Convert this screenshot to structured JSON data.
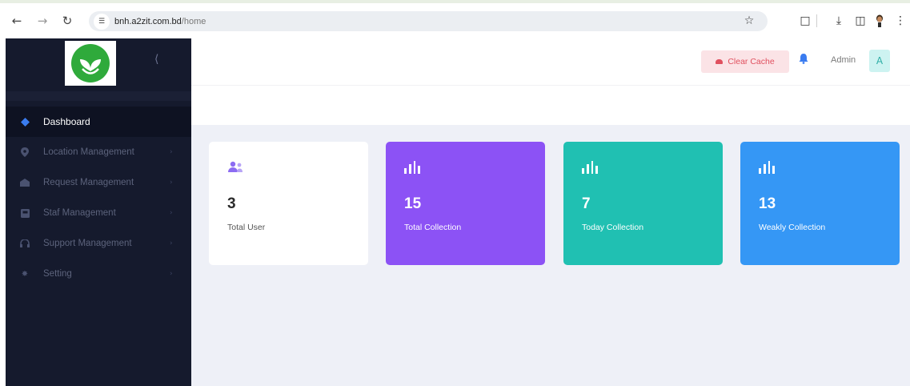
{
  "browser": {
    "url_host": "bnh.a2zit.com.bd",
    "url_path": "/home"
  },
  "sidebar": {
    "menu": [
      {
        "label": "Dashboard",
        "icon": "diamond-icon",
        "active": true,
        "has_arrow": false
      },
      {
        "label": "Location Management",
        "icon": "location-pin-icon",
        "active": false,
        "has_arrow": true
      },
      {
        "label": "Request Management",
        "icon": "request-icon",
        "active": false,
        "has_arrow": true
      },
      {
        "label": "Staf Management",
        "icon": "staff-icon",
        "active": false,
        "has_arrow": true
      },
      {
        "label": "Support Management",
        "icon": "headset-icon",
        "active": false,
        "has_arrow": true
      },
      {
        "label": "Setting",
        "icon": "gear-icon",
        "active": false,
        "has_arrow": true
      }
    ]
  },
  "header": {
    "clear_cache_label": "Clear Cache",
    "admin_label": "Admin",
    "avatar_initial": "A"
  },
  "cards": [
    {
      "value": "3",
      "label": "Total User",
      "icon": "users-icon",
      "color": "#ffffff"
    },
    {
      "value": "15",
      "label": "Total Collection",
      "icon": "bar-chart-icon",
      "color": "#8c52f5"
    },
    {
      "value": "7",
      "label": "Today Collection",
      "icon": "bar-chart-icon",
      "color": "#20c0b2"
    },
    {
      "value": "13",
      "label": "Weakly Collection",
      "icon": "bar-chart-icon",
      "color": "#3597f5"
    }
  ],
  "colors": {
    "sidebar_bg": "#151a2d",
    "content_bg": "#eef0f7",
    "accent_blue": "#3a7cf0",
    "danger": "#e0505f"
  }
}
